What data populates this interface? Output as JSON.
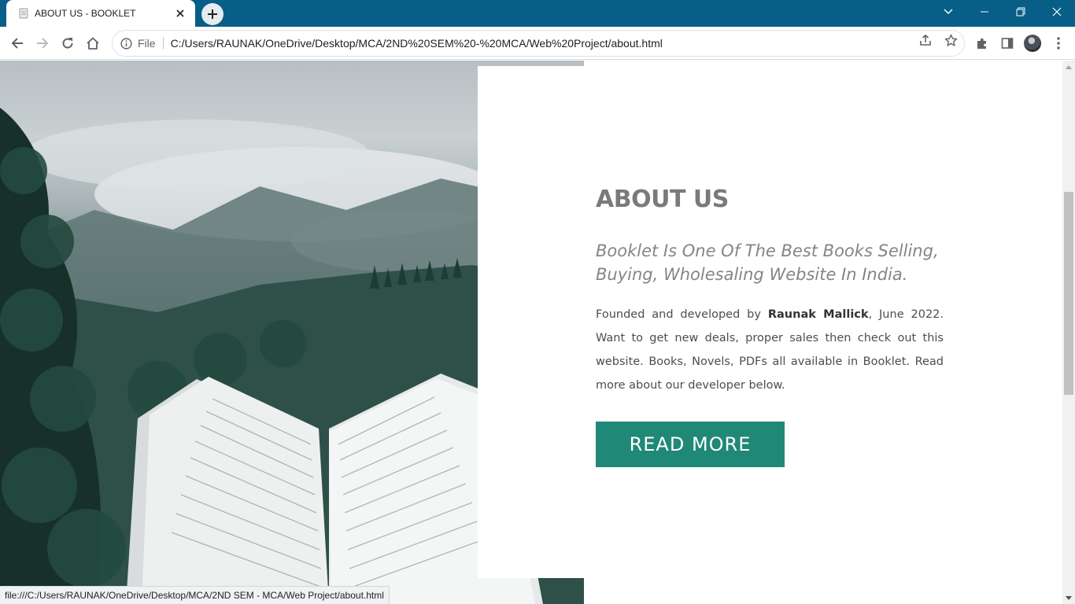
{
  "browser": {
    "tab": {
      "title": "ABOUT US - BOOKLET",
      "favicon": "page-favicon-icon"
    },
    "address_bar": {
      "scheme_label": "File",
      "url": "C:/Users/RAUNAK/OneDrive/Desktop/MCA/2ND%20SEM%20-%20MCA/Web%20Project/about.html"
    },
    "status_text": "file:///C:/Users/RAUNAK/OneDrive/Desktop/MCA/2ND SEM - MCA/Web Project/about.html",
    "colors": {
      "frame": "#075e87",
      "toolbar": "#ffffff"
    }
  },
  "page": {
    "about": {
      "heading": "ABOUT US",
      "tagline": "Booklet Is One Of The Best Books Selling, Buying, Wholesaling Website In India.",
      "body_prefix": "Founded and developed by ",
      "author": "Raunak Mallick",
      "body_suffix": ", June 2022. Want to get new deals, proper sales then check out this website. Books, Novels, PDFs all available in Booklet. Read more about our developer below.",
      "button_label": "READ MORE"
    },
    "image": {
      "description_icon": "open-book-forest-image"
    },
    "colors": {
      "accent": "#208876",
      "heading": "#7a7a7a",
      "text": "#4d4d4d"
    }
  }
}
